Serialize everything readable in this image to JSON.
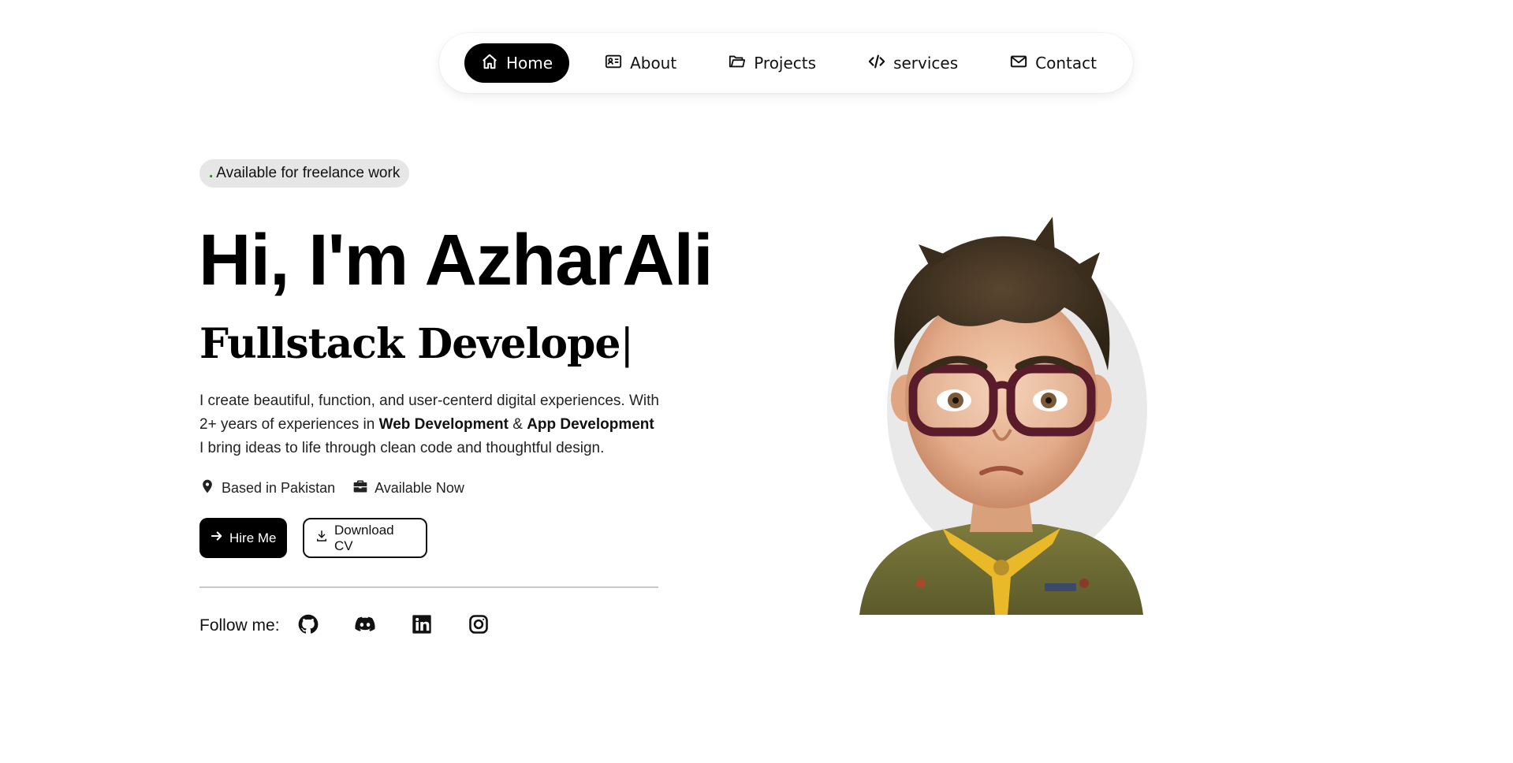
{
  "nav": {
    "items": [
      {
        "label": "Home",
        "icon": "home-icon",
        "active": true
      },
      {
        "label": "About",
        "icon": "id-card-icon"
      },
      {
        "label": "Projects",
        "icon": "folder-icon"
      },
      {
        "label": "services",
        "icon": "code-icon"
      },
      {
        "label": "Contact",
        "icon": "mail-icon"
      }
    ]
  },
  "hero": {
    "badge": {
      "dot": ".",
      "text": "Available for freelance work"
    },
    "title": "Hi, I'm AzharAli",
    "role": "Fullstack Develope",
    "caret": "|",
    "bio": {
      "line1": "I create beautiful, function, and user-centerd digital experiences. With",
      "line2_pre": "2+ years of experiences in ",
      "skill1": "Web Development",
      "amp": " & ",
      "skill2": "App Development",
      "line3": "I bring ideas to life through clean code and thoughtful design."
    },
    "meta": {
      "location": "Based in Pakistan",
      "availability": "Available Now"
    },
    "buttons": {
      "hire": "Hire Me",
      "download": "Download CV"
    },
    "follow": {
      "label": "Follow me:",
      "icons": [
        "github-icon",
        "discord-icon",
        "linkedin-icon",
        "instagram-icon"
      ]
    }
  },
  "colors": {
    "accent": "#000000",
    "badge_bg": "#e6e6e6",
    "text": "#111111"
  }
}
